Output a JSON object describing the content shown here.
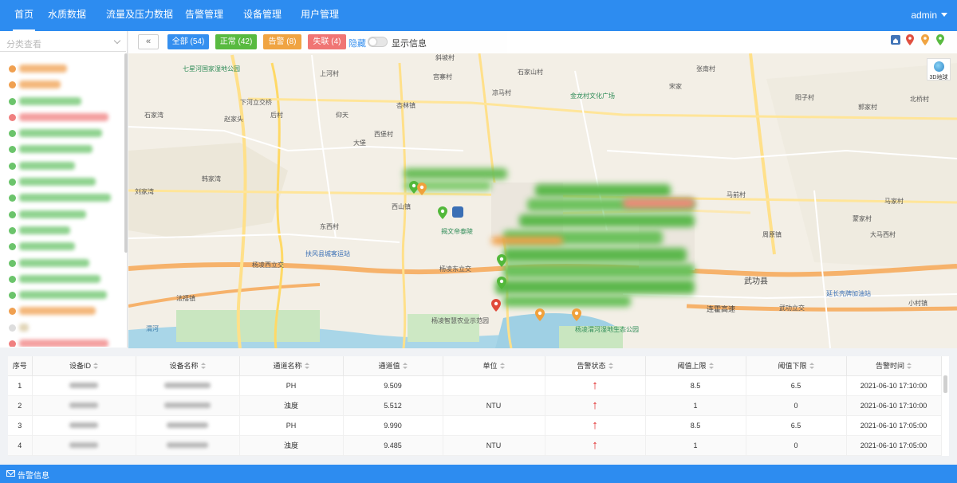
{
  "nav": {
    "items": [
      "首页",
      "水质数据",
      "流量及压力数据",
      "告警管理",
      "设备管理",
      "用户管理"
    ],
    "active": "首页",
    "user": "admin"
  },
  "sidebar": {
    "search_placeholder": "分类查看",
    "item_status_colors": [
      "#f0a050",
      "#f0a050",
      "#6bc46b",
      "#f08080",
      "#6bc46b",
      "#6bc46b",
      "#6bc46b",
      "#6bc46b",
      "#6bc46b",
      "#6bc46b",
      "#6bc46b",
      "#6bc46b",
      "#6bc46b",
      "#6bc46b",
      "#6bc46b",
      "#f0a050",
      "#dddddd",
      "#f08080",
      "#6bc46b"
    ]
  },
  "toolbar": {
    "collapse_label": "«",
    "filters": [
      {
        "label": "全部 (54)",
        "color": "#2d8cf0"
      },
      {
        "label": "正常 (42)",
        "color": "#52b83a"
      },
      {
        "label": "告警 (8)",
        "color": "#f0a13c"
      },
      {
        "label": "失联 (4)",
        "color": "#f07070"
      }
    ],
    "hide_label": "隐藏",
    "show_info_label": "显示信息"
  },
  "map": {
    "three_d_label": "3D地球",
    "labels": [
      "七星河国家湿地公园",
      "上河村",
      "斜坡村",
      "宫寨村",
      "石家山村",
      "阳子村",
      "郭家村",
      "杏林镇",
      "下河立交桥",
      "石家湾",
      "赵家头",
      "后村",
      "仰天",
      "大堡",
      "西堡村",
      "凉马村",
      "金龙村文化广场",
      "宋家",
      "张南村",
      "刘家湾",
      "周原镇",
      "西山镇",
      "北桥村",
      "韩家湾",
      "马前村",
      "东西村",
      "杨凌西立交",
      "杨凌东立交",
      "扶风县城客运站",
      "延长壳牌加油站",
      "揭文帝泰陵",
      "连霍高速",
      "武功县",
      "武功立交",
      "杨凌智慧农业示范园",
      "杨凌渭河湿地生态公园",
      "渭河",
      "小村镇",
      "法禧镇",
      "大马西村",
      "马家村",
      "蒙家村"
    ]
  },
  "table": {
    "columns": [
      "序号",
      "设备ID",
      "设备名称",
      "通道名称",
      "通道值",
      "单位",
      "告警状态",
      "阈值上限",
      "阈值下限",
      "告警时间"
    ],
    "rows": [
      {
        "index": "1",
        "channel": "PH",
        "value": "9.509",
        "unit": "",
        "status": "↑",
        "upper": "8.5",
        "lower": "6.5",
        "time": "2021-06-10 17:10:00"
      },
      {
        "index": "2",
        "channel": "浊度",
        "value": "5.512",
        "unit": "NTU",
        "status": "↑",
        "upper": "1",
        "lower": "0",
        "time": "2021-06-10 17:10:00"
      },
      {
        "index": "3",
        "channel": "PH",
        "value": "9.990",
        "unit": "",
        "status": "↑",
        "upper": "8.5",
        "lower": "6.5",
        "time": "2021-06-10 17:05:00"
      },
      {
        "index": "4",
        "channel": "浊度",
        "value": "9.485",
        "unit": "NTU",
        "status": "↑",
        "upper": "1",
        "lower": "0",
        "time": "2021-06-10 17:05:00"
      }
    ]
  },
  "footer": {
    "label": "告警信息"
  }
}
